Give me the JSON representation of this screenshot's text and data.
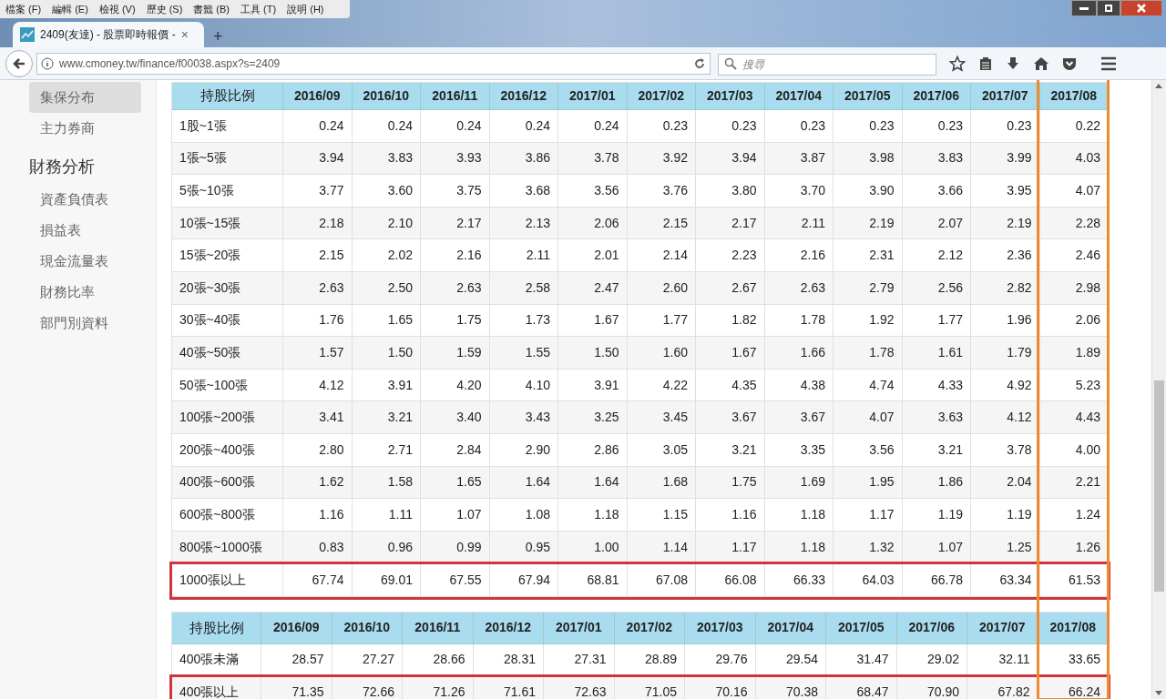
{
  "menu_bar": [
    "檔案 (F)",
    "編輯 (E)",
    "檢視 (V)",
    "歷史 (S)",
    "書籤 (B)",
    "工具 (T)",
    "說明 (H)"
  ],
  "tab": {
    "title": "2409(友達) - 股票即時報價 -",
    "close": "×",
    "new_tab": "+"
  },
  "address_bar": {
    "url": "www.cmoney.tw/finance/f00038.aspx?s=2409"
  },
  "search": {
    "placeholder": "搜尋"
  },
  "sidebar": {
    "items": [
      {
        "label": "集保分布",
        "kind": "item",
        "selected": true
      },
      {
        "label": "主力券商",
        "kind": "item",
        "selected": false
      },
      {
        "label": "財務分析",
        "kind": "heading",
        "selected": false
      },
      {
        "label": "資產負債表",
        "kind": "item",
        "selected": false
      },
      {
        "label": "損益表",
        "kind": "item",
        "selected": false
      },
      {
        "label": "現金流量表",
        "kind": "item",
        "selected": false
      },
      {
        "label": "財務比率",
        "kind": "item",
        "selected": false
      },
      {
        "label": "部門別資料",
        "kind": "item",
        "selected": false
      }
    ]
  },
  "tables": [
    {
      "columns": [
        "持股比例",
        "2016/09",
        "2016/10",
        "2016/11",
        "2016/12",
        "2017/01",
        "2017/02",
        "2017/03",
        "2017/04",
        "2017/05",
        "2017/06",
        "2017/07",
        "2017/08"
      ],
      "highlighted_column": true,
      "rows": [
        {
          "cells": [
            "1股~1張",
            "0.24",
            "0.24",
            "0.24",
            "0.24",
            "0.24",
            "0.23",
            "0.23",
            "0.23",
            "0.23",
            "0.23",
            "0.23",
            "0.22"
          ],
          "highlighted": false
        },
        {
          "cells": [
            "1張~5張",
            "3.94",
            "3.83",
            "3.93",
            "3.86",
            "3.78",
            "3.92",
            "3.94",
            "3.87",
            "3.98",
            "3.83",
            "3.99",
            "4.03"
          ],
          "highlighted": false
        },
        {
          "cells": [
            "5張~10張",
            "3.77",
            "3.60",
            "3.75",
            "3.68",
            "3.56",
            "3.76",
            "3.80",
            "3.70",
            "3.90",
            "3.66",
            "3.95",
            "4.07"
          ],
          "highlighted": false
        },
        {
          "cells": [
            "10張~15張",
            "2.18",
            "2.10",
            "2.17",
            "2.13",
            "2.06",
            "2.15",
            "2.17",
            "2.11",
            "2.19",
            "2.07",
            "2.19",
            "2.28"
          ],
          "highlighted": false
        },
        {
          "cells": [
            "15張~20張",
            "2.15",
            "2.02",
            "2.16",
            "2.11",
            "2.01",
            "2.14",
            "2.23",
            "2.16",
            "2.31",
            "2.12",
            "2.36",
            "2.46"
          ],
          "highlighted": false
        },
        {
          "cells": [
            "20張~30張",
            "2.63",
            "2.50",
            "2.63",
            "2.58",
            "2.47",
            "2.60",
            "2.67",
            "2.63",
            "2.79",
            "2.56",
            "2.82",
            "2.98"
          ],
          "highlighted": false
        },
        {
          "cells": [
            "30張~40張",
            "1.76",
            "1.65",
            "1.75",
            "1.73",
            "1.67",
            "1.77",
            "1.82",
            "1.78",
            "1.92",
            "1.77",
            "1.96",
            "2.06"
          ],
          "highlighted": false
        },
        {
          "cells": [
            "40張~50張",
            "1.57",
            "1.50",
            "1.59",
            "1.55",
            "1.50",
            "1.60",
            "1.67",
            "1.66",
            "1.78",
            "1.61",
            "1.79",
            "1.89"
          ],
          "highlighted": false
        },
        {
          "cells": [
            "50張~100張",
            "4.12",
            "3.91",
            "4.20",
            "4.10",
            "3.91",
            "4.22",
            "4.35",
            "4.38",
            "4.74",
            "4.33",
            "4.92",
            "5.23"
          ],
          "highlighted": false
        },
        {
          "cells": [
            "100張~200張",
            "3.41",
            "3.21",
            "3.40",
            "3.43",
            "3.25",
            "3.45",
            "3.67",
            "3.67",
            "4.07",
            "3.63",
            "4.12",
            "4.43"
          ],
          "highlighted": false
        },
        {
          "cells": [
            "200張~400張",
            "2.80",
            "2.71",
            "2.84",
            "2.90",
            "2.86",
            "3.05",
            "3.21",
            "3.35",
            "3.56",
            "3.21",
            "3.78",
            "4.00"
          ],
          "highlighted": false
        },
        {
          "cells": [
            "400張~600張",
            "1.62",
            "1.58",
            "1.65",
            "1.64",
            "1.64",
            "1.68",
            "1.75",
            "1.69",
            "1.95",
            "1.86",
            "2.04",
            "2.21"
          ],
          "highlighted": false
        },
        {
          "cells": [
            "600張~800張",
            "1.16",
            "1.11",
            "1.07",
            "1.08",
            "1.18",
            "1.15",
            "1.16",
            "1.18",
            "1.17",
            "1.19",
            "1.19",
            "1.24"
          ],
          "highlighted": false
        },
        {
          "cells": [
            "800張~1000張",
            "0.83",
            "0.96",
            "0.99",
            "0.95",
            "1.00",
            "1.14",
            "1.17",
            "1.18",
            "1.32",
            "1.07",
            "1.25",
            "1.26"
          ],
          "highlighted": false
        },
        {
          "cells": [
            "1000張以上",
            "67.74",
            "69.01",
            "67.55",
            "67.94",
            "68.81",
            "67.08",
            "66.08",
            "66.33",
            "64.03",
            "66.78",
            "63.34",
            "61.53"
          ],
          "highlighted": true
        }
      ]
    },
    {
      "columns": [
        "持股比例",
        "2016/09",
        "2016/10",
        "2016/11",
        "2016/12",
        "2017/01",
        "2017/02",
        "2017/03",
        "2017/04",
        "2017/05",
        "2017/06",
        "2017/07",
        "2017/08"
      ],
      "highlighted_column": true,
      "rows": [
        {
          "cells": [
            "400張未滿",
            "28.57",
            "27.27",
            "28.66",
            "28.31",
            "27.31",
            "28.89",
            "29.76",
            "29.54",
            "31.47",
            "29.02",
            "32.11",
            "33.65"
          ],
          "highlighted": false
        },
        {
          "cells": [
            "400張以上",
            "71.35",
            "72.66",
            "71.26",
            "71.61",
            "72.63",
            "71.05",
            "70.16",
            "70.38",
            "68.47",
            "70.90",
            "67.82",
            "66.24"
          ],
          "highlighted": true
        }
      ]
    }
  ]
}
